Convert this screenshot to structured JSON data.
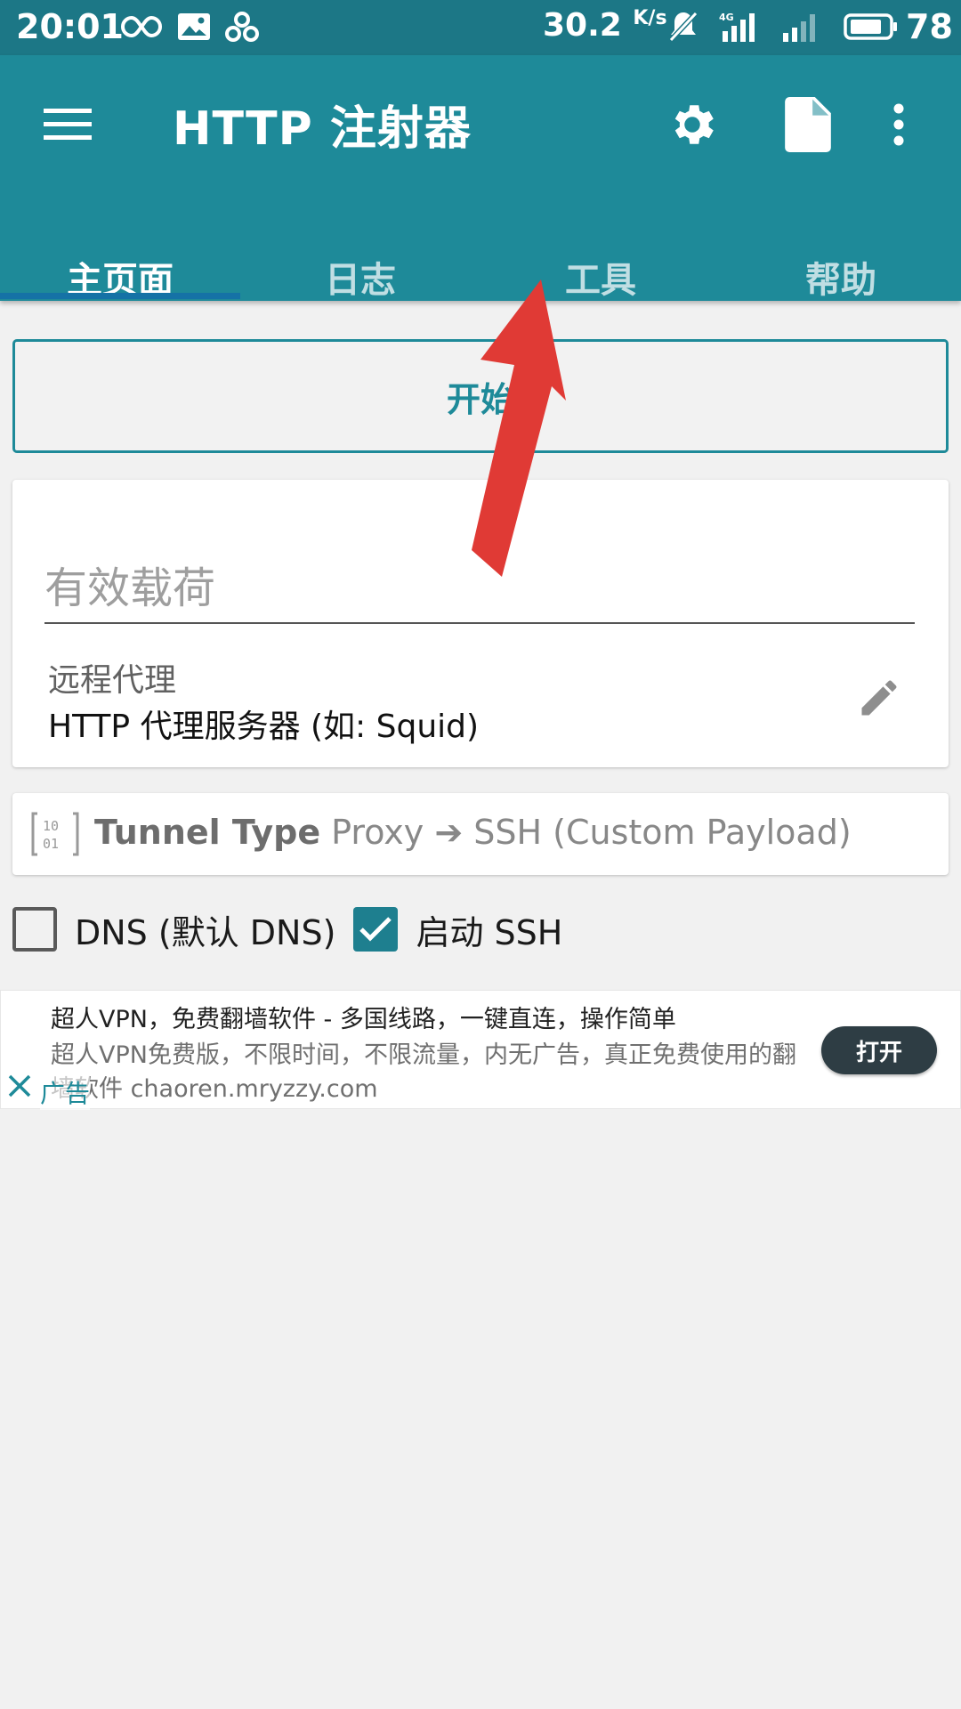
{
  "status_bar": {
    "time": "20:01",
    "net_speed": "30.2",
    "net_speed_unit": "K/s",
    "battery": "78",
    "icons": [
      "infinity-icon",
      "image-icon",
      "pinwheel-icon",
      "mute-bell-icon",
      "signal-4g-icon",
      "signal-icon",
      "battery-icon"
    ]
  },
  "app_bar": {
    "title": "HTTP 注射器",
    "actions": [
      "menu-icon",
      "settings-icon",
      "file-icon",
      "more-vert-icon"
    ],
    "color": "#1e8a99"
  },
  "tabs": [
    {
      "label": "主页面",
      "active": true
    },
    {
      "label": "日志",
      "active": false
    },
    {
      "label": "工具",
      "active": false
    },
    {
      "label": "帮助",
      "active": false
    }
  ],
  "main": {
    "start_label": "开始",
    "payload_placeholder": "有效载荷",
    "proxy_label": "远程代理",
    "proxy_value": "HTTP 代理服务器 (如: Squid)",
    "tunnel_key": "Tunnel Type",
    "tunnel_value": " Proxy ➔ SSH (Custom Payload)",
    "dns_label": "DNS (默认 DNS)",
    "dns_checked": false,
    "ssh_label": "启动 SSH",
    "ssh_checked": true
  },
  "ad": {
    "title": "超人VPN，免费翻墙软件 - 多国线路，一键直连，操作简单",
    "desc_line1": "超人VPN免费版，不限时间，不限流量，内无广告，真正免费使用的翻",
    "desc_line2": "墙软件 chaoren.mryzzy.com",
    "tag": "广告",
    "open_label": "打开"
  }
}
